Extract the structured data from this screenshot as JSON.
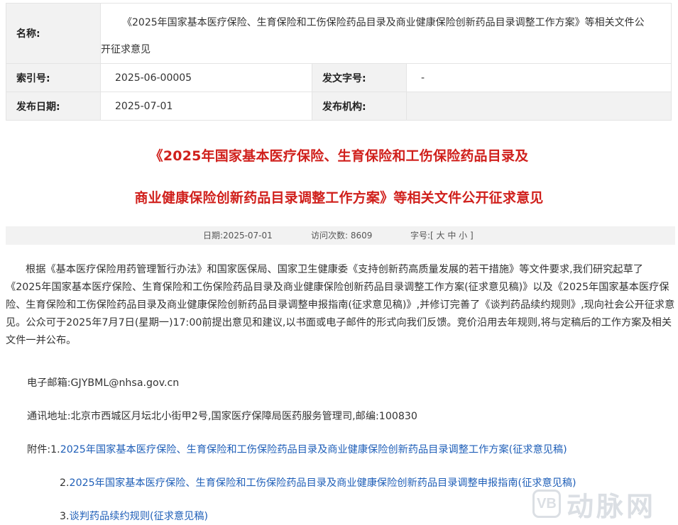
{
  "meta": {
    "name_key": "名称:",
    "name_line1": "《2025年国家基本医疗保险、生育保险和工伤保险药品目录及商业健康保险创新药品目录调整工作方案》等相关文件公",
    "name_line2": "开征求意见",
    "index_key": "索引号:",
    "index_val": "2025-06-00005",
    "docno_key": "发文字号:",
    "docno_val": "-",
    "date_key": "发布日期:",
    "date_val": "2025-07-01",
    "org_key": "发布机构:",
    "org_val": ""
  },
  "title": {
    "line1": "《2025年国家基本医疗保险、生育保险和工伤保险药品目录及",
    "line2": "商业健康保险创新药品目录调整工作方案》等相关文件公开征求意见"
  },
  "info_bar": {
    "date": "日期:2025-07-01",
    "visits": "访问次数: 8609",
    "fontsize": "字号:[ 大 中 小 ]"
  },
  "body": {
    "paragraph": "根据《基本医疗保险用药管理暂行办法》和国家医保局、国家卫生健康委《支持创新药高质量发展的若干措施》等文件要求,我们研究起草了《2025年国家基本医疗保险、生育保险和工伤保险药品目录及商业健康保险创新药品目录调整工作方案(征求意见稿)》以及《2025年国家基本医疗保险、生育保险和工伤保险药品目录及商业健康保险创新药品目录调整申报指南(征求意见稿)》,并修订完善了《谈判药品续约规则》,现向社会公开征求意见。公众可于2025年7月7日(星期一)17:00前提出意见和建议,以书面或电子邮件的形式向我们反馈。竞价沿用去年规则,将与定稿后的工作方案及相关文件一并公布。",
    "email": "电子邮箱:GJYBML@nhsa.gov.cn",
    "address": "通讯地址:北京市西城区月坛北小街甲2号,国家医疗保障局医药服务管理司,邮编:100830",
    "attach_label": "附件:",
    "attachments": [
      {
        "num": "1.",
        "title": "2025年国家基本医疗保险、生育保险和工伤保险药品目录及商业健康保险创新药品目录调整工作方案(征求意见稿)"
      },
      {
        "num": "2.",
        "title": "2025年国家基本医疗保险、生育保险和工伤保险药品目录及商业健康保险创新药品目录调整申报指南(征求意见稿)"
      },
      {
        "num": "3.",
        "title": "谈判药品续约规则(征求意见稿)"
      }
    ]
  },
  "watermark": {
    "logo": "VB",
    "text": "动脉网"
  },
  "colors": {
    "title_red": "#d0201c",
    "link_blue": "#1f5fb8",
    "label_bg": "#f2f2f2"
  }
}
